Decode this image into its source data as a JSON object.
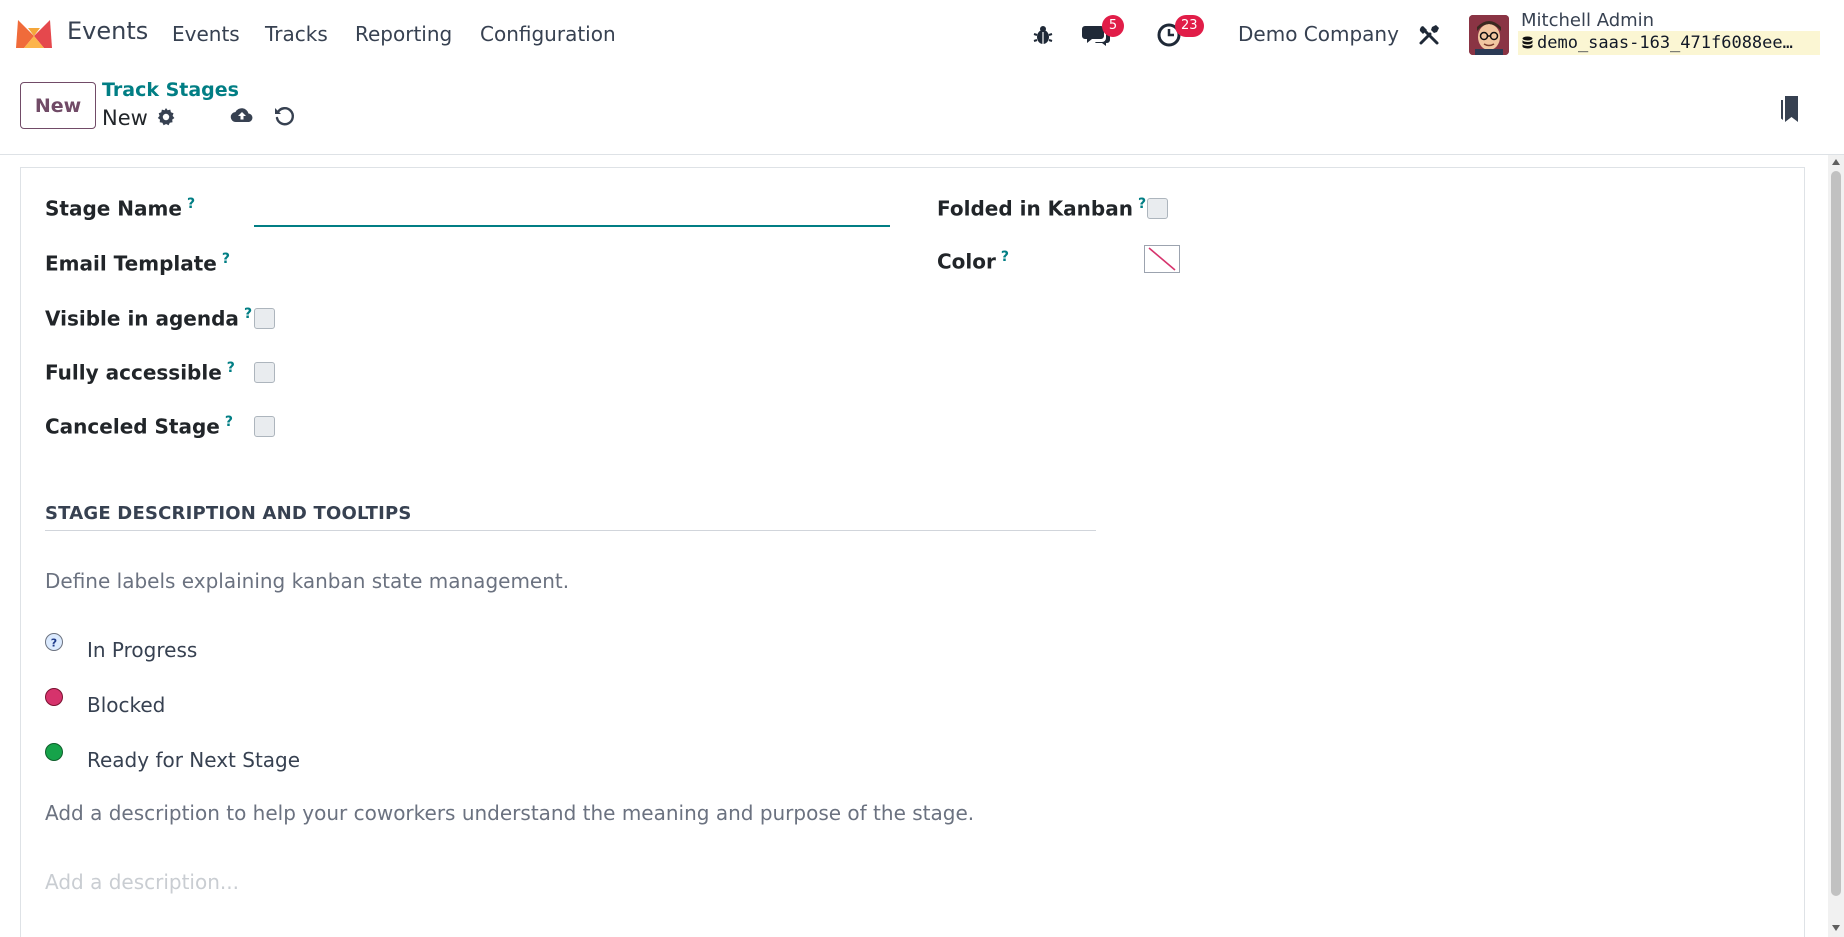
{
  "navbar": {
    "app_name": "Events",
    "menu": [
      "Events",
      "Tracks",
      "Reporting",
      "Configuration"
    ],
    "messages_count": "5",
    "activities_count": "23",
    "company": "Demo Company",
    "user_name": "Mitchell Admin",
    "database": "demo_saas-163_471f6088ee…"
  },
  "control": {
    "new_label": "New",
    "breadcrumb": "Track Stages",
    "record_name": "New"
  },
  "form": {
    "stage_name_label": "Stage Name",
    "stage_name_value": "",
    "email_template_label": "Email Template",
    "visible_in_agenda_label": "Visible in agenda",
    "fully_accessible_label": "Fully accessible",
    "canceled_stage_label": "Canceled Stage",
    "folded_in_kanban_label": "Folded in Kanban",
    "color_label": "Color",
    "help_marker": "?",
    "section_title": "STAGE DESCRIPTION AND TOOLTIPS",
    "section_help": "Define labels explaining kanban state management.",
    "states": [
      {
        "label": "In Progress",
        "color": "#dbeafe"
      },
      {
        "label": "Blocked",
        "color": "#d6336c"
      },
      {
        "label": "Ready for Next Stage",
        "color": "#16a34a"
      }
    ],
    "description_help": "Add a description to help your coworkers understand the meaning and purpose of the stage.",
    "description_placeholder": "Add a description..."
  },
  "colors": {
    "brand": "#714b67",
    "accent": "#017e84",
    "badge": "#e11d48"
  }
}
